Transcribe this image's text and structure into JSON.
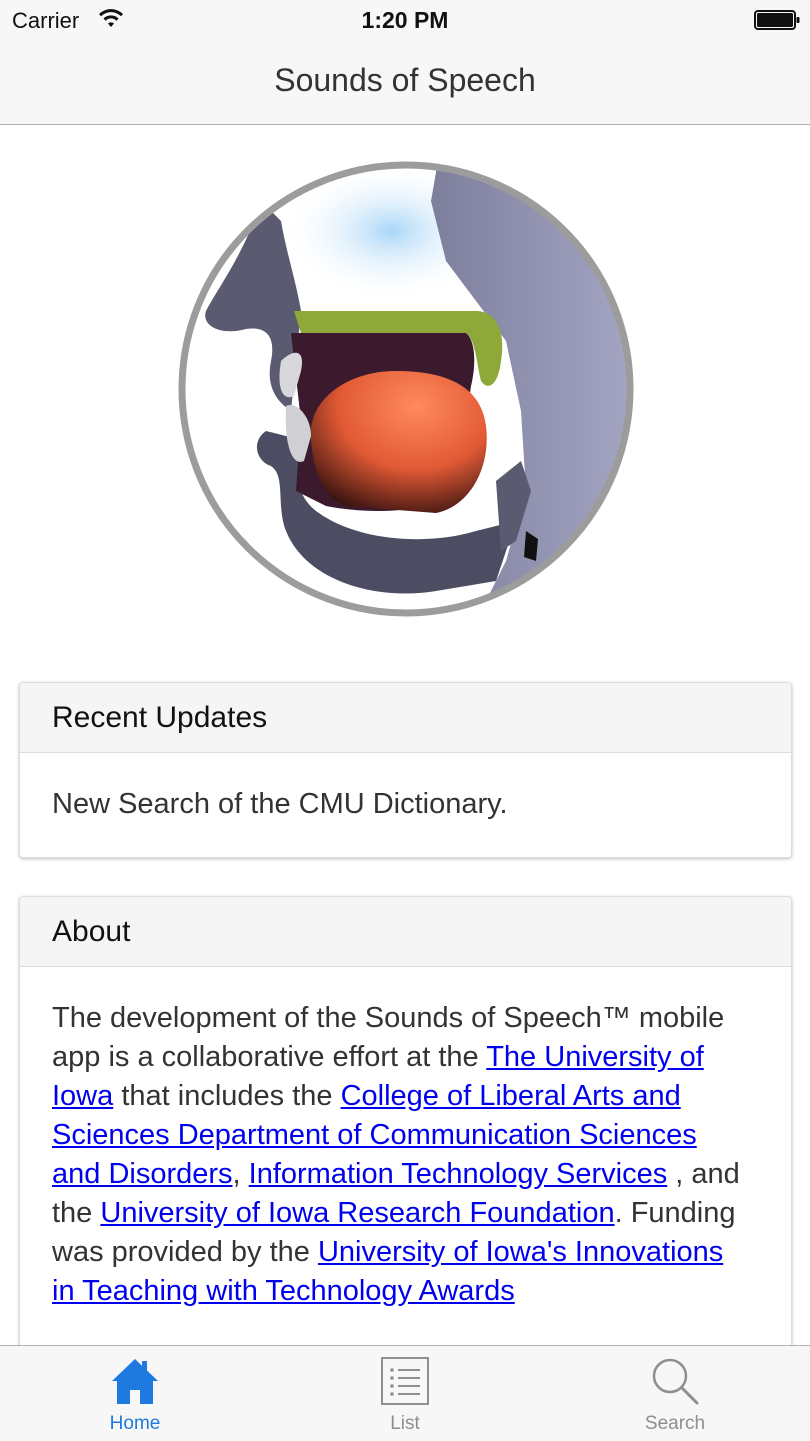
{
  "status_bar": {
    "carrier": "Carrier",
    "time": "1:20 PM"
  },
  "nav": {
    "title": "Sounds of Speech"
  },
  "logo": {
    "icon": "vocal-tract-logo-icon"
  },
  "recent_updates": {
    "heading": "Recent Updates",
    "body": "New Search of the CMU Dictionary."
  },
  "about": {
    "heading": "About",
    "text_1": "The development of the Sounds of Speech™ mobile app is a collaborative effort at the ",
    "link_1": "The University of Iowa",
    "text_2": " that includes the ",
    "link_2": "College of Liberal Arts and Sciences Department of Communication Sciences and Disorders",
    "text_3": ", ",
    "link_3": "Information Technology Services",
    "text_4": " , and the ",
    "link_4": "University of Iowa Research Foundation",
    "text_5": ". Funding was provided by the ",
    "link_5": "University of Iowa's Innovations in Teaching with Technology Awards"
  },
  "tab_bar": {
    "home": "Home",
    "list": "List",
    "search": "Search",
    "active": "Home"
  },
  "colors": {
    "accent": "#1f7ae0",
    "link": "#0000ee",
    "bar_background": "#f7f7f7",
    "inactive_tab": "#8e8e93"
  }
}
